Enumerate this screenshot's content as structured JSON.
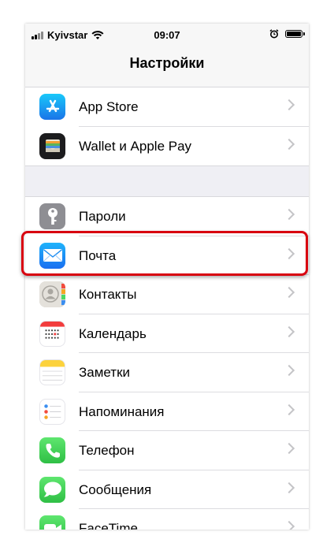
{
  "status_bar": {
    "carrier": "Kyivstar",
    "time": "09:07",
    "signal_icon": "signal-bars-icon",
    "wifi_icon": "wifi-icon",
    "alarm_icon": "alarm-clock-icon",
    "battery_icon": "battery-icon"
  },
  "navbar": {
    "title": "Настройки"
  },
  "groups": [
    {
      "items": [
        {
          "label": "App Store",
          "icon": "app-store-icon",
          "color": "#1a8cf2"
        },
        {
          "label": "Wallet и Apple Pay",
          "icon": "wallet-icon",
          "color": "#1c1c1e"
        }
      ]
    },
    {
      "items": [
        {
          "label": "Пароли",
          "icon": "key-icon",
          "color": "#8e8e93"
        },
        {
          "label": "Почта",
          "icon": "mail-icon",
          "color": "#1a8cf2"
        },
        {
          "label": "Контакты",
          "icon": "contacts-icon",
          "color": "#d6d3cd"
        },
        {
          "label": "Календарь",
          "icon": "calendar-icon",
          "color": "#ffffff"
        },
        {
          "label": "Заметки",
          "icon": "notes-icon",
          "color": "#ffffff"
        },
        {
          "label": "Напоминания",
          "icon": "reminders-icon",
          "color": "#ffffff"
        },
        {
          "label": "Телефон",
          "icon": "phone-icon",
          "color": "#34c759"
        },
        {
          "label": "Сообщения",
          "icon": "messages-icon",
          "color": "#34c759"
        },
        {
          "label": "FaceTime",
          "icon": "facetime-icon",
          "color": "#34c759"
        }
      ]
    }
  ],
  "highlight": {
    "target": "Почта",
    "color": "#d8000f"
  }
}
